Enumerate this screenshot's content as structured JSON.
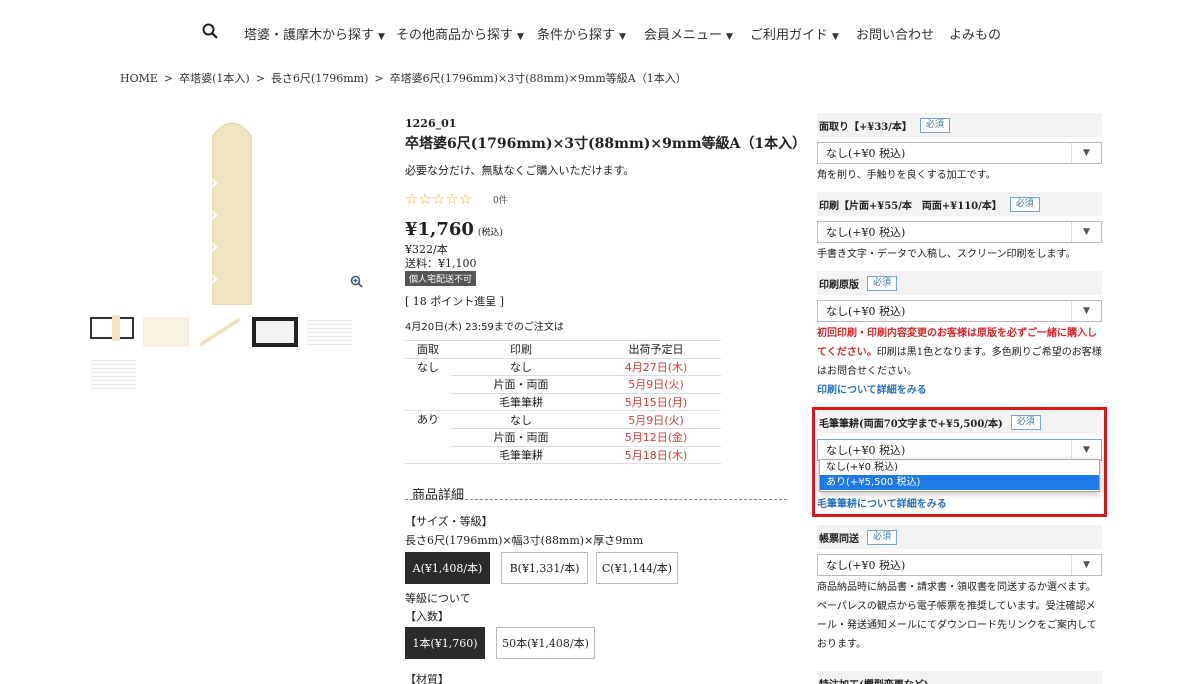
{
  "nav": {
    "items": [
      {
        "label": "塔婆・護摩木から探す",
        "chevron": true
      },
      {
        "label": "その他商品から探す",
        "chevron": true
      },
      {
        "label": "条件から探す",
        "chevron": true
      },
      {
        "label": "会員メニュー",
        "chevron": true
      },
      {
        "label": "ご利用ガイド",
        "chevron": true
      },
      {
        "label": "お問い合わせ",
        "chevron": false
      },
      {
        "label": "よみもの",
        "chevron": false
      }
    ]
  },
  "breadcrumb": [
    "HOME",
    "卒塔婆(1本入)",
    "長さ6尺(1796mm)",
    "卒塔婆6尺(1796mm)×3寸(88mm)×9mm等級A（1本入）"
  ],
  "product": {
    "sku": "1226_01",
    "title": "卒塔婆6尺(1796mm)×3寸(88mm)×9mm等級A（1本入）",
    "description": "必要な分だけ、無駄なくご購入いただけます。",
    "stars": "☆☆☆☆☆",
    "rating": 0,
    "review_count": "0件",
    "price": "¥1,760",
    "price_tax": "(税込)",
    "unit_price": "¥322/本",
    "shipping": "送料：¥1,100",
    "badge": "個人宅配送不可",
    "points": "[ 18 ポイント進呈 ]",
    "deadline": "4月20日(木) 23:59までのご注文は"
  },
  "schedule": {
    "headers": [
      "面取",
      "印刷",
      "出荷予定日"
    ],
    "groups": [
      {
        "chamfer": "なし",
        "rows": [
          [
            "なし",
            "4月27日(木)"
          ],
          [
            "片面・両面",
            "5月9日(火)"
          ],
          [
            "毛筆筆耕",
            "5月15日(月)"
          ]
        ]
      },
      {
        "chamfer": "あり",
        "rows": [
          [
            "なし",
            "5月9日(火)"
          ],
          [
            "片面・両面",
            "5月12日(金)"
          ],
          [
            "毛筆筆耕",
            "5月18日(木)"
          ]
        ]
      }
    ]
  },
  "details": {
    "section_title": "商品詳細",
    "size_label": "【サイズ・等級】",
    "size_value": "長さ6尺(1796mm)×幅3寸(88mm)×厚さ9mm",
    "grades": [
      "A(¥1,408/本)",
      "B(¥1,331/本)",
      "C(¥1,144/本)"
    ],
    "grade_note": "等級について",
    "qty_label": "【入数】",
    "quantities": [
      "1本(¥1,760)",
      "50本(¥1,408/本)"
    ],
    "material_label": "【材質】"
  },
  "options": {
    "required": "必須",
    "chamfer": {
      "title": "面取り【+¥33/本】",
      "value": "なし(+¥0 税込)",
      "note": "角を削り、手触りを良くする加工です。"
    },
    "print": {
      "title": "印刷【片面+¥55/本　両面+¥110/本】",
      "value": "なし(+¥0 税込)",
      "note": "手書き文字・データで入稿し、スクリーン印刷をします。"
    },
    "plate": {
      "title": "印刷原版",
      "value": "なし(+¥0 税込)",
      "note_red": "初回印刷・印刷内容変更のお客様は原版を必ずご一緒に購入してください。",
      "note": "印刷は黒1色となります。多色刷りご希望のお客様はお問合せください。",
      "link": "印刷について詳細をみる"
    },
    "brush": {
      "title": "毛筆筆耕(両面70文字まで+¥5,500/本)",
      "value": "なし(+¥0 税込)",
      "dropdown": [
        "なし(+¥0 税込)",
        "あり(+¥5,500 税込)"
      ],
      "link": "毛筆筆耕について詳細をみる"
    },
    "invoice": {
      "title": "帳票同送",
      "value": "なし(+¥0 税込)",
      "note": "商品納品時に納品書・請求書・領収書を同送するか選べます。ペーパレスの観点から電子帳票を推奨しています。受注確認メール・発送通知メールにてダウンロード先リンクをご案内しております。"
    },
    "special": {
      "title": "特注加工(欄型変更など)"
    }
  }
}
